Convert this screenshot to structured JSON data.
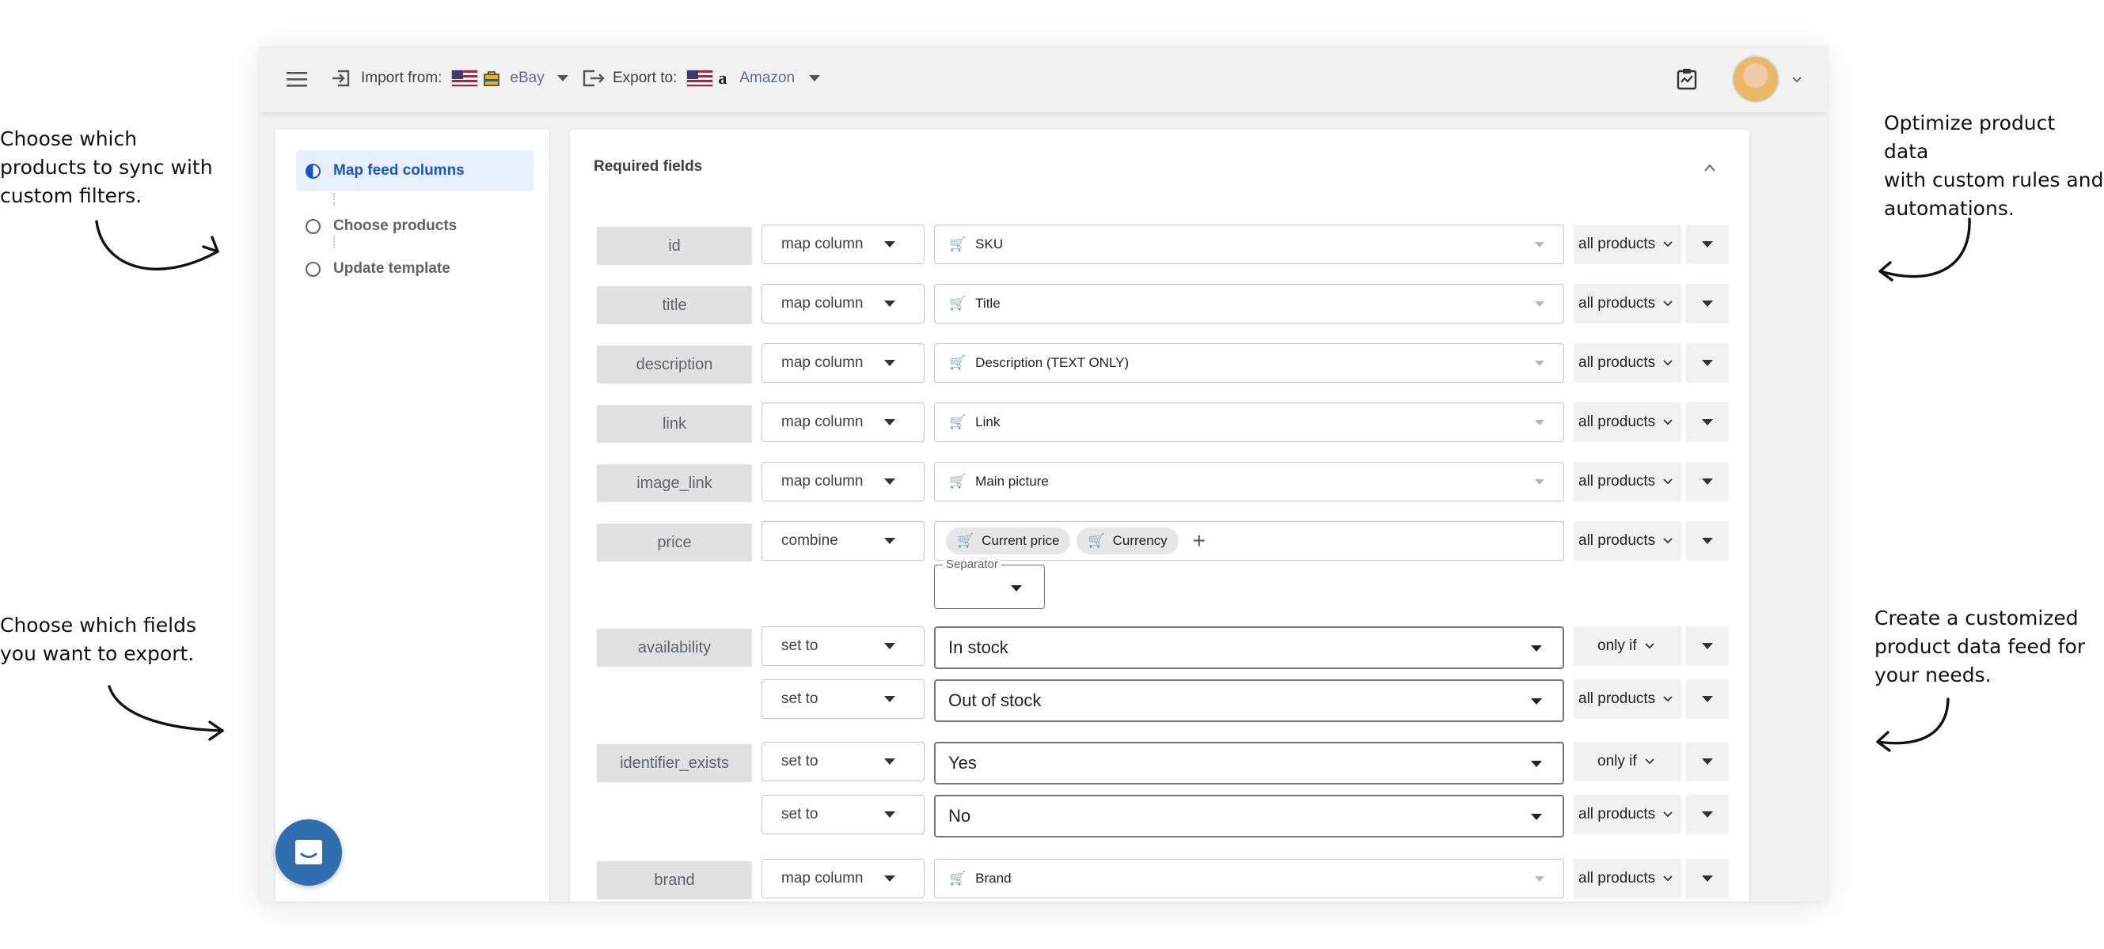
{
  "callouts": {
    "left_top": "Choose which\nproducts to sync with\ncustom filters.",
    "left_bottom": "Choose which fields\nyou want to export.",
    "right_top": "Optimize product data\nwith custom rules and\nautomations.",
    "right_bottom": "Create a customized\nproduct data feed for\nyour needs."
  },
  "topbar": {
    "menu_icon": "hamburger-menu-icon",
    "import_label": "Import from:",
    "import_source": "eBay",
    "export_label": "Export to:",
    "export_target": "Amazon",
    "report_icon": "clipboard-chart-icon",
    "avatar_icon": "user-avatar"
  },
  "sidebar": {
    "steps": [
      {
        "label": "Map feed columns",
        "active": true
      },
      {
        "label": "Choose products",
        "active": false
      },
      {
        "label": "Update template",
        "active": false
      }
    ]
  },
  "panel": {
    "title": "Required fields",
    "rows": [
      {
        "field": "id",
        "mode": "map column",
        "source": "SKU",
        "scope": "all products"
      },
      {
        "field": "title",
        "mode": "map column",
        "source": "Title",
        "scope": "all products"
      },
      {
        "field": "description",
        "mode": "map column",
        "source": "Description (TEXT ONLY)",
        "scope": "all products"
      },
      {
        "field": "link",
        "mode": "map column",
        "source": "Link",
        "scope": "all products"
      },
      {
        "field": "image_link",
        "mode": "map column",
        "source": "Main picture",
        "scope": "all products"
      },
      {
        "field": "price",
        "mode": "combine",
        "chips": [
          "Current price",
          "Currency"
        ],
        "scope": "all products",
        "separator_label": "Separator"
      },
      {
        "field": "availability",
        "rules": [
          {
            "mode": "set to",
            "value": "In stock",
            "scope": "only if"
          },
          {
            "mode": "set to",
            "value": "Out of stock",
            "scope": "all products"
          }
        ]
      },
      {
        "field": "identifier_exists",
        "rules": [
          {
            "mode": "set to",
            "value": "Yes",
            "scope": "only if"
          },
          {
            "mode": "set to",
            "value": "No",
            "scope": "all products"
          }
        ]
      },
      {
        "field": "brand",
        "mode": "map column",
        "source": "Brand",
        "scope": "all products"
      }
    ]
  },
  "chat": {
    "icon": "chat-bubble-icon"
  },
  "colors": {
    "accent": "#1a56c4",
    "active_step_bg": "#e8f0fe",
    "chat": "#2f6fb0"
  }
}
